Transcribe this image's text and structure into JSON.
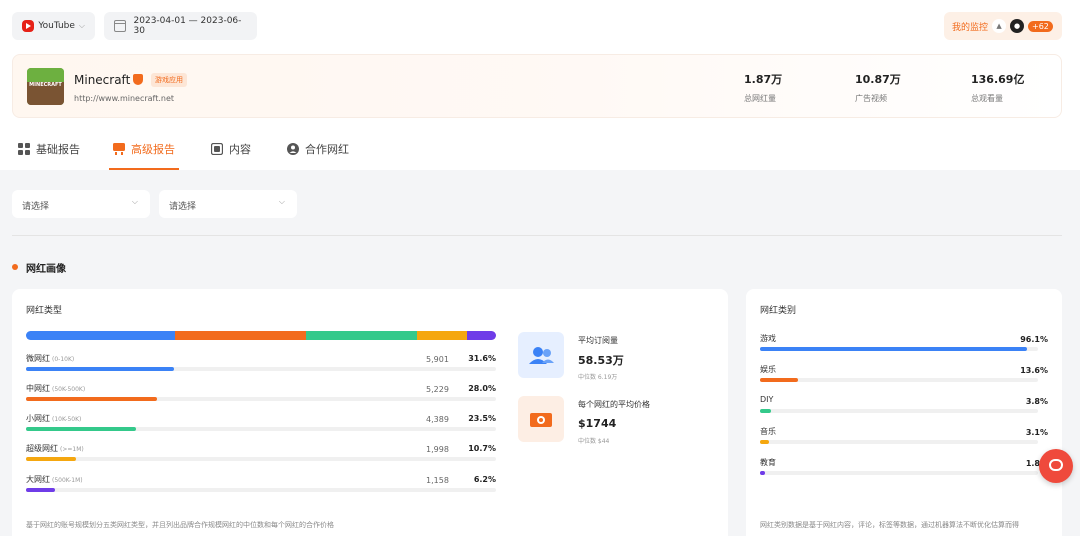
{
  "filters": {
    "platform": "YouTube",
    "date_range": "2023-04-01 — 2023-06-30"
  },
  "monitor": {
    "label": "我的监控",
    "badge": "+62"
  },
  "brand": {
    "logo_text": "MINECRAFT",
    "name": "Minecraft",
    "tag": "游戏应用",
    "url": "http://www.minecraft.net",
    "stats": [
      {
        "value": "1.87万",
        "label": "总网红量"
      },
      {
        "value": "10.87万",
        "label": "广告视频"
      },
      {
        "value": "136.69亿",
        "label": "总观看量"
      }
    ]
  },
  "tabs": [
    {
      "label": "基础报告",
      "active": false,
      "icon": "grid-icon"
    },
    {
      "label": "高级报告",
      "active": true,
      "icon": "advanced-report-icon"
    },
    {
      "label": "内容",
      "active": false,
      "icon": "content-icon"
    },
    {
      "label": "合作网红",
      "active": false,
      "icon": "user-icon"
    }
  ],
  "selects": [
    {
      "placeholder": "请选择"
    },
    {
      "placeholder": "请选择"
    }
  ],
  "section_title": "网红画像",
  "influencer_types": {
    "title": "网红类型",
    "rows": [
      {
        "name": "微网红",
        "range": "(0-10K)",
        "count": "5,901",
        "pct": "31.6%",
        "value": 31.6,
        "color": "#3b82f6"
      },
      {
        "name": "中网红",
        "range": "(50K-500K)",
        "count": "5,229",
        "pct": "28.0%",
        "value": 28.0,
        "color": "#f26b1d"
      },
      {
        "name": "小网红",
        "range": "(10K-50K)",
        "count": "4,389",
        "pct": "23.5%",
        "value": 23.5,
        "color": "#34c98b"
      },
      {
        "name": "超级网红",
        "range": "(>=1M)",
        "count": "1,998",
        "pct": "10.7%",
        "value": 10.7,
        "color": "#f5a70f"
      },
      {
        "name": "大网红",
        "range": "(500K-1M)",
        "count": "1,158",
        "pct": "6.2%",
        "value": 6.2,
        "color": "#6f3ce8"
      }
    ],
    "footer": "基于网红的账号规模划分五类网红类型，并且列出品牌合作规模网红的中位数和每个网红的合作价格"
  },
  "kpis": [
    {
      "label": "平均订阅量",
      "value": "58.53万",
      "sub": "中位数 6.19万",
      "icon": "users-icon",
      "bg": "#e6efff",
      "fg": "#3b82f6"
    },
    {
      "label": "每个网红的平均价格",
      "value": "$1744",
      "sub": "中位数 $44",
      "icon": "money-icon",
      "bg": "#fdeee4",
      "fg": "#f26b1d"
    }
  ],
  "categories": {
    "title": "网红类别",
    "rows": [
      {
        "name": "游戏",
        "pct": "96.1%",
        "value": 96.1,
        "color": "#3b82f6"
      },
      {
        "name": "娱乐",
        "pct": "13.6%",
        "value": 13.6,
        "color": "#f26b1d"
      },
      {
        "name": "DIY",
        "pct": "3.8%",
        "value": 3.8,
        "color": "#34c98b"
      },
      {
        "name": "音乐",
        "pct": "3.1%",
        "value": 3.1,
        "color": "#f5a70f"
      },
      {
        "name": "教育",
        "pct": "1.8%",
        "value": 1.8,
        "color": "#6f3ce8"
      }
    ],
    "footer": "网红类别数据是基于网红内容，评论，标签等数据，通过机器算法不断优化估算而得"
  }
}
